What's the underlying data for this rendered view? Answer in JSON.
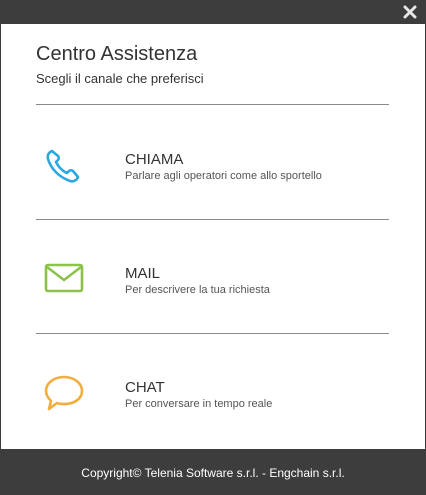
{
  "dialog": {
    "title": "Centro Assistenza",
    "subtitle": "Scegli il canale che preferisci",
    "close_icon": "close-icon"
  },
  "options": [
    {
      "title": "CHIAMA",
      "description": "Parlare agli operatori come allo sportello",
      "icon": "phone-icon",
      "color": "#29a9e0"
    },
    {
      "title": "MAIL",
      "description": "Per descrivere la tua richiesta",
      "icon": "mail-icon",
      "color": "#8cc24a"
    },
    {
      "title": "CHAT",
      "description": "Per conversare in tempo reale",
      "icon": "chat-icon",
      "color": "#f2ad3f"
    }
  ],
  "footer": {
    "text": "Copyright© Telenia Software s.r.l. - Engchain s.r.l."
  },
  "colors": {
    "frame": "#3d3d3d",
    "panel": "#ffffff",
    "divider": "#8a8a8a"
  }
}
